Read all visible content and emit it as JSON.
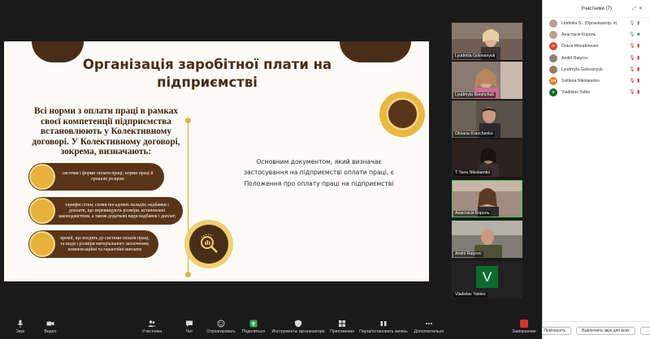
{
  "slide": {
    "title": "Організація заробітної плати на підприємстві",
    "intro": "Всі норми з оплати праці в рамках своєї компетенції підприємства встановлюють у Колективному договорі. У Колективному договорі, зокрема, визначають:",
    "main_doc": "Основним документом, який визначає застосування на підприємстві оплати праці, є Положення про оплату праці на підприємстві",
    "pills": [
      "системи і форми оплати праці; норми праці й грошові розціни",
      "тарифні сітки; схеми посадових окладів; надбавки і доплати, що перевищують розміри, встановлені законодавством, а також додаткові види надбавок і доплат;",
      "премії, що входять до системи оплати праці, та види і розміри матеріального заохочення; компенсаційні та гарантійні виплати"
    ]
  },
  "video_tiles": [
    {
      "name": "Lyudmila Golovanyuk",
      "type": "photo",
      "bg": "#6f5d55"
    },
    {
      "name": "Lyudmyla Borshchuk",
      "type": "photo",
      "bg": "#8a7a72"
    },
    {
      "name": "Oksana Kravchenko",
      "type": "photo",
      "bg": "#5a5148"
    },
    {
      "name": "T Yana Nikolaenko",
      "type": "photo",
      "bg": "#2c2320"
    },
    {
      "name": "Анастасія Король",
      "type": "photo",
      "bg": "#a08c80",
      "active": true
    },
    {
      "name": "Andrii Ratyrov",
      "type": "photo",
      "bg": "#7e7d75"
    },
    {
      "name": "Vladislav Yatsko",
      "type": "avatar",
      "letter": "V"
    }
  ],
  "participants": {
    "title": "Участники (7)",
    "items": [
      {
        "name": "Liudmila S.. (Организатор, я)",
        "avatar_color": "#b9a291",
        "initial": "",
        "mic": "ok",
        "cam": "ok"
      },
      {
        "name": "Анастасія Король",
        "avatar_color": "#c49c86",
        "initial": "",
        "mic": "ok",
        "cam": "on"
      },
      {
        "name": "Ольга Михайленко",
        "avatar_color": "#e0442f",
        "initial": "О",
        "mic": "muted",
        "cam": "off"
      },
      {
        "name": "Andrii Ratyrov",
        "avatar_color": "#8a8070",
        "initial": "",
        "mic": "muted",
        "cam": "off"
      },
      {
        "name": "Lyudmyla Golovanyuk",
        "avatar_color": "#9a7b6a",
        "initial": "",
        "mic": "muted",
        "cam": "off"
      },
      {
        "name": "Svitlana Nikolaienko",
        "avatar_color": "#e27a1f",
        "initial": "SN",
        "mic": "muted",
        "cam": "off"
      },
      {
        "name": "Vladislav Yatko",
        "avatar_color": "#0c6b2e",
        "initial": "V",
        "mic": "muted",
        "cam": "off"
      }
    ],
    "invite_label": "Пригласить",
    "mute_all_label": "Выключить звук для всех"
  },
  "toolbar": {
    "items": [
      {
        "label": "Звук",
        "icon": "mic-icon"
      },
      {
        "label": "Видео",
        "icon": "video-icon"
      },
      {
        "label": "Участники",
        "icon": "participants-icon"
      },
      {
        "label": "Чат",
        "icon": "chat-icon"
      },
      {
        "label": "Отреагировать",
        "icon": "react-icon"
      },
      {
        "label": "Поделиться",
        "icon": "share-icon"
      },
      {
        "label": "Инструменты организатора",
        "icon": "host-tools-icon"
      },
      {
        "label": "Приложения",
        "icon": "apps-icon"
      },
      {
        "label": "Пауза/остановить запись",
        "icon": "record-icon"
      },
      {
        "label": "Дополнительно",
        "icon": "more-icon"
      },
      {
        "label": "Завершение",
        "icon": "end-icon"
      }
    ]
  },
  "colors": {
    "slide_brown": "#5a3418",
    "slide_gold": "#e6b23c",
    "end_red": "#d8322e",
    "active_green": "#3bcb5c"
  }
}
